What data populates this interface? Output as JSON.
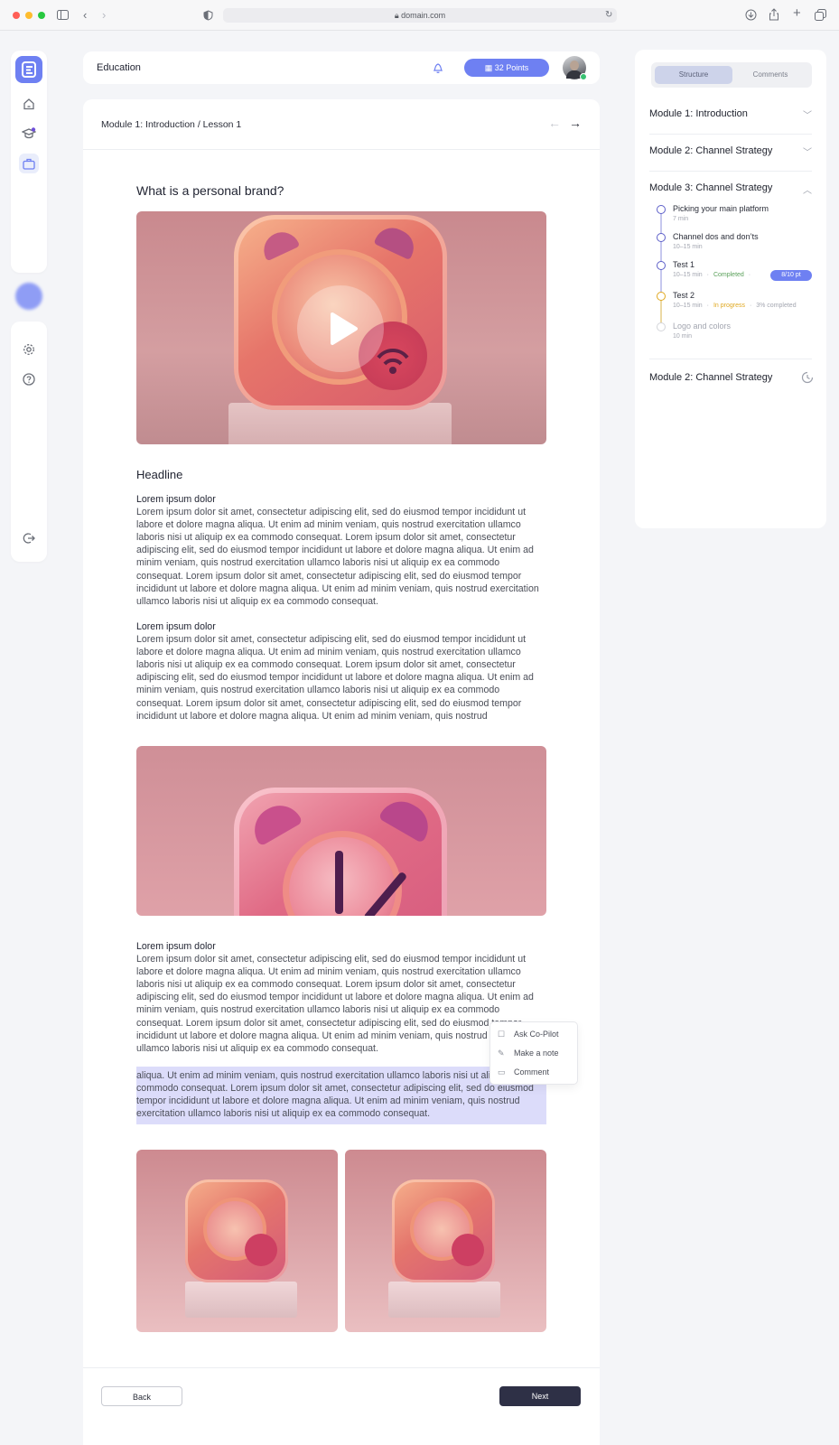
{
  "browser": {
    "url": "domain.com"
  },
  "header": {
    "title": "Education",
    "points": "32 Points"
  },
  "breadcrumb": "Module 1: Introduction / Lesson 1",
  "lesson": {
    "title": "What is a personal brand?",
    "headline": "Headline",
    "sections": [
      {
        "heading": "Lorem ipsum dolor",
        "body": "Lorem ipsum dolor sit amet, consectetur adipiscing elit, sed do eiusmod tempor incididunt ut labore et dolore magna aliqua. Ut enim ad minim veniam, quis nostrud exercitation ullamco laboris nisi ut aliquip ex ea commodo consequat. Lorem ipsum dolor sit amet, consectetur adipiscing elit, sed do eiusmod tempor incididunt ut labore et dolore magna aliqua. Ut enim ad minim veniam, quis nostrud exercitation ullamco laboris nisi ut aliquip ex ea commodo consequat. Lorem ipsum dolor sit amet, consectetur adipiscing elit, sed do eiusmod tempor incididunt ut labore et dolore magna aliqua. Ut enim ad minim veniam, quis nostrud exercitation ullamco laboris nisi ut aliquip ex ea commodo consequat."
      },
      {
        "heading": "Lorem ipsum dolor",
        "body": "Lorem ipsum dolor sit amet, consectetur adipiscing elit, sed do eiusmod tempor incididunt ut labore et dolore magna aliqua. Ut enim ad minim veniam, quis nostrud exercitation ullamco laboris nisi ut aliquip ex ea commodo consequat. Lorem ipsum dolor sit amet, consectetur adipiscing elit, sed do eiusmod tempor incididunt ut labore et dolore magna aliqua. Ut enim ad minim veniam, quis nostrud exercitation ullamco laboris nisi ut aliquip ex ea commodo consequat. Lorem ipsum dolor sit amet, consectetur adipiscing elit, sed do eiusmod tempor incididunt ut labore et dolore magna aliqua. Ut enim ad minim veniam, quis nostrud"
      },
      {
        "heading": "Lorem ipsum dolor",
        "body": "Lorem ipsum dolor sit amet, consectetur adipiscing elit, sed do eiusmod tempor incididunt ut labore et dolore magna aliqua. Ut enim ad minim veniam, quis nostrud exercitation ullamco laboris nisi ut aliquip ex ea commodo consequat. Lorem ipsum dolor sit amet, consectetur adipiscing elit, sed do eiusmod tempor incididunt ut labore et dolore magna aliqua. Ut enim ad minim veniam, quis nostrud exercitation ullamco laboris nisi ut aliquip ex ea commodo consequat. Lorem ipsum dolor sit amet, consectetur adipiscing elit, sed do eiusmod tempor incididunt ut labore et dolore magna aliqua. Ut enim ad minim veniam, quis nostrud exercitation ullamco laboris nisi ut aliquip ex ea commodo consequat."
      }
    ],
    "selected_text": "aliqua. Ut enim ad minim veniam, quis nostrud exercitation ullamco laboris nisi ut aliquip ex ea commodo consequat. Lorem ipsum dolor sit amet, consectetur adipiscing elit, sed do eiusmod tempor incididunt ut labore et dolore magna aliqua. Ut enim ad minim veniam, quis nostrud exercitation ullamco laboris nisi ut aliquip ex ea commodo consequat."
  },
  "context_menu": [
    "Ask Co-Pilot",
    "Make a note",
    "Comment"
  ],
  "footer": {
    "back": "Back",
    "next": "Next"
  },
  "panel": {
    "tabs": [
      "Structure",
      "Comments"
    ],
    "modules": [
      "Module 1: Introduction",
      "Module 2: Channel Strategy",
      "Module 3: Channel Strategy",
      "Module 2: Channel Strategy"
    ],
    "lessons": [
      {
        "title": "Picking your main platform",
        "duration": "7 min"
      },
      {
        "title": "Channel dos and don’ts",
        "duration": "10–15 min"
      },
      {
        "title": "Test 1",
        "duration": "10–15 min",
        "status": "Completed",
        "score": "8/10 pt"
      },
      {
        "title": "Test 2",
        "duration": "10–15 min",
        "status": "In progress",
        "progress": "3% completed"
      },
      {
        "title": "Logo and colors",
        "duration": "10 min"
      }
    ]
  },
  "colors": {
    "accent": "#6a7ff0",
    "dark_button": "#2e3046",
    "completed": "#5aa05a",
    "in_progress": "#e0a820",
    "selection": "#dcdcfa"
  },
  "icons": [
    "home-icon",
    "graduation-icon",
    "briefcase-icon",
    "settings-icon",
    "help-icon",
    "logout-icon",
    "bell-icon",
    "play-icon"
  ]
}
